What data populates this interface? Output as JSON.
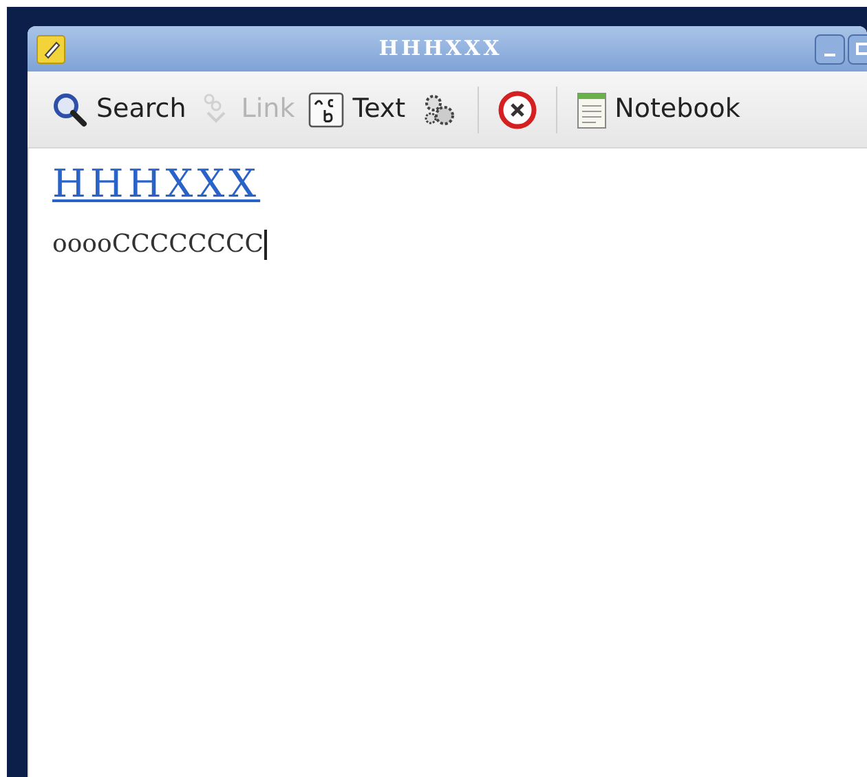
{
  "window": {
    "title": "HHHXXX"
  },
  "toolbar": [
    {
      "kind": "button",
      "label": "Search",
      "disabled": false
    },
    {
      "kind": "button",
      "label": "Link",
      "disabled": true
    },
    {
      "kind": "button",
      "label": "Text",
      "disabled": false
    },
    {
      "kind": "button",
      "disabled": false
    },
    {
      "kind": "separator"
    },
    {
      "kind": "button",
      "disabled": false
    },
    {
      "kind": "separator"
    },
    {
      "kind": "button",
      "label": "Notebook",
      "disabled": false
    }
  ],
  "note": {
    "title": "HHHXXX",
    "body": "ooooCCCCCCCC"
  }
}
